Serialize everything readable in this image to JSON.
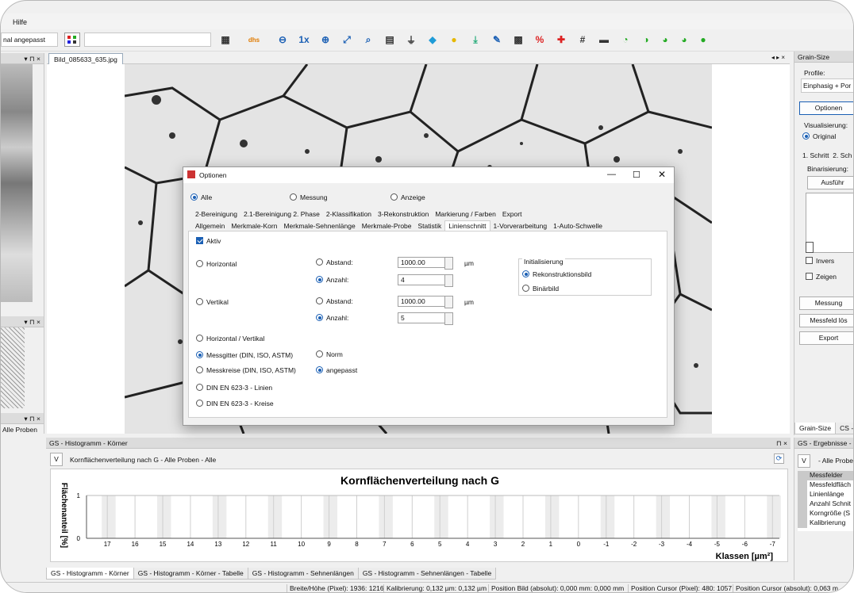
{
  "menu": {
    "help": "Hilfe"
  },
  "toolbar": {
    "zoom_combo": "nal angepasst",
    "combo2": "",
    "icons": [
      "grid-icon",
      "dhs-icon",
      "zoom-out-icon",
      "zoom-1x-icon",
      "zoom-in-icon",
      "zoom-fit-icon",
      "zoom-select-icon",
      "table-icon",
      "filter-icon",
      "cube-icon",
      "bulb-icon",
      "download-icon",
      "pen-icon",
      "pattern-icon",
      "percent-icon",
      "cross-icon",
      "hash-icon",
      "flag-icon",
      "pie-icon"
    ]
  },
  "left": {
    "graph_label": "Alle Proben"
  },
  "doc": {
    "tab": "Bild_085633_635.jpg"
  },
  "right": {
    "title": "Grain-Size",
    "profile_label": "Profile:",
    "profile_value": "Einphasig + Por",
    "options_btn": "Optionen",
    "visual_label": "Visualisierung:",
    "visual_original": "Original",
    "tab1": "1. Schritt",
    "tab2": "2. Sch",
    "binar_label": "Binarisierung:",
    "run_btn": "Ausführ",
    "invers": "Invers",
    "show": "Zeigen",
    "measure_btn": "Messung",
    "field_btn": "Messfeld lös",
    "export_btn": "Export",
    "bottom_tab1": "Grain-Size",
    "bottom_tab2": "CS - K"
  },
  "results": {
    "title": "GS - Ergebnisse - P",
    "v": "V",
    "samples": "- Alle Probe",
    "items": [
      "Messfelder",
      "Messfeldfläch",
      "Linienlänge",
      "Anzahl Schnit",
      "Korngröße (S",
      "Kalibrierung"
    ]
  },
  "dialog": {
    "title": "Optionen",
    "scope": [
      "Alle",
      "Messung",
      "Anzeige"
    ],
    "tabs_row1": [
      "2-Bereinigung",
      "2.1-Bereinigung 2. Phase",
      "2-Klassifikation",
      "3-Rekonstruktion",
      "Markierung / Farben",
      "Export"
    ],
    "tabs_row2": [
      "Allgemein",
      "Merkmale-Korn",
      "Merkmale-Sehnenlänge",
      "Merkmale-Probe",
      "Statistik",
      "Linienschnitt",
      "1-Vorverarbeitung",
      "1-Auto-Schwelle"
    ],
    "active": "Aktiv",
    "horizontal": "Horizontal",
    "vertical": "Vertikal",
    "abstand": "Abstand:",
    "anzahl": "Anzahl:",
    "h_abstand": "1000.00",
    "h_anzahl": "4",
    "v_abstand": "1000.00",
    "v_anzahl": "5",
    "unit": "µm",
    "init_title": "Initialisierung",
    "init_recon": "Rekonstruktionsbild",
    "init_binary": "Binärbild",
    "hv": "Horizontal / Vertikal",
    "messgitter": "Messgitter (DIN, ISO, ASTM)",
    "messkreise": "Messkreise (DIN, ISO, ASTM)",
    "norm": "Norm",
    "angepasst": "angepasst",
    "din_lines": "DIN EN 623-3 - Linien",
    "din_circles": "DIN EN 623-3 - Kreise"
  },
  "histogram": {
    "panel_title": "GS - Histogramm - Körner",
    "v": "V",
    "subtitle": "Kornflächenverteilung nach G - Alle Proben - Alle",
    "tabs": [
      "GS - Histogramm - Körner",
      "GS - Histogramm - Körner - Tabelle",
      "GS - Histogramm - Sehnenlängen",
      "GS - Histogramm - Sehnenlängen - Tabelle"
    ]
  },
  "chart_data": {
    "type": "bar",
    "title": "Kornflächenverteilung nach G",
    "xlabel": "Klassen [µm²]",
    "ylabel": "Flächenanteil [%]",
    "categories": [
      "17",
      "16",
      "15",
      "14",
      "13",
      "12",
      "11",
      "10",
      "9",
      "8",
      "7",
      "6",
      "5",
      "4",
      "3",
      "2",
      "1",
      "0",
      "-1",
      "-2",
      "-3",
      "-4",
      "-5",
      "-6",
      "-7"
    ],
    "values": [
      0,
      0,
      0,
      0,
      0,
      0,
      0,
      0,
      0,
      0,
      0,
      0,
      0,
      0,
      0,
      0,
      0,
      0,
      0,
      0,
      0,
      0,
      0,
      0,
      0
    ],
    "y_ticks": [
      "1",
      "0"
    ],
    "grid": true
  },
  "status": [
    "Breite/Höhe (Pixel): 1936: 1216",
    "Kalibrierung: 0,132 µm: 0,132 µm",
    "Position Bild (absolut): 0,000 mm: 0,000 mm",
    "Position Cursor (Pixel): 480: 1057",
    "Position Cursor (absolut): 0,063 m"
  ],
  "colors": {
    "accent": "#1a5fb4",
    "dialog_bg": "#f0f0f0"
  }
}
